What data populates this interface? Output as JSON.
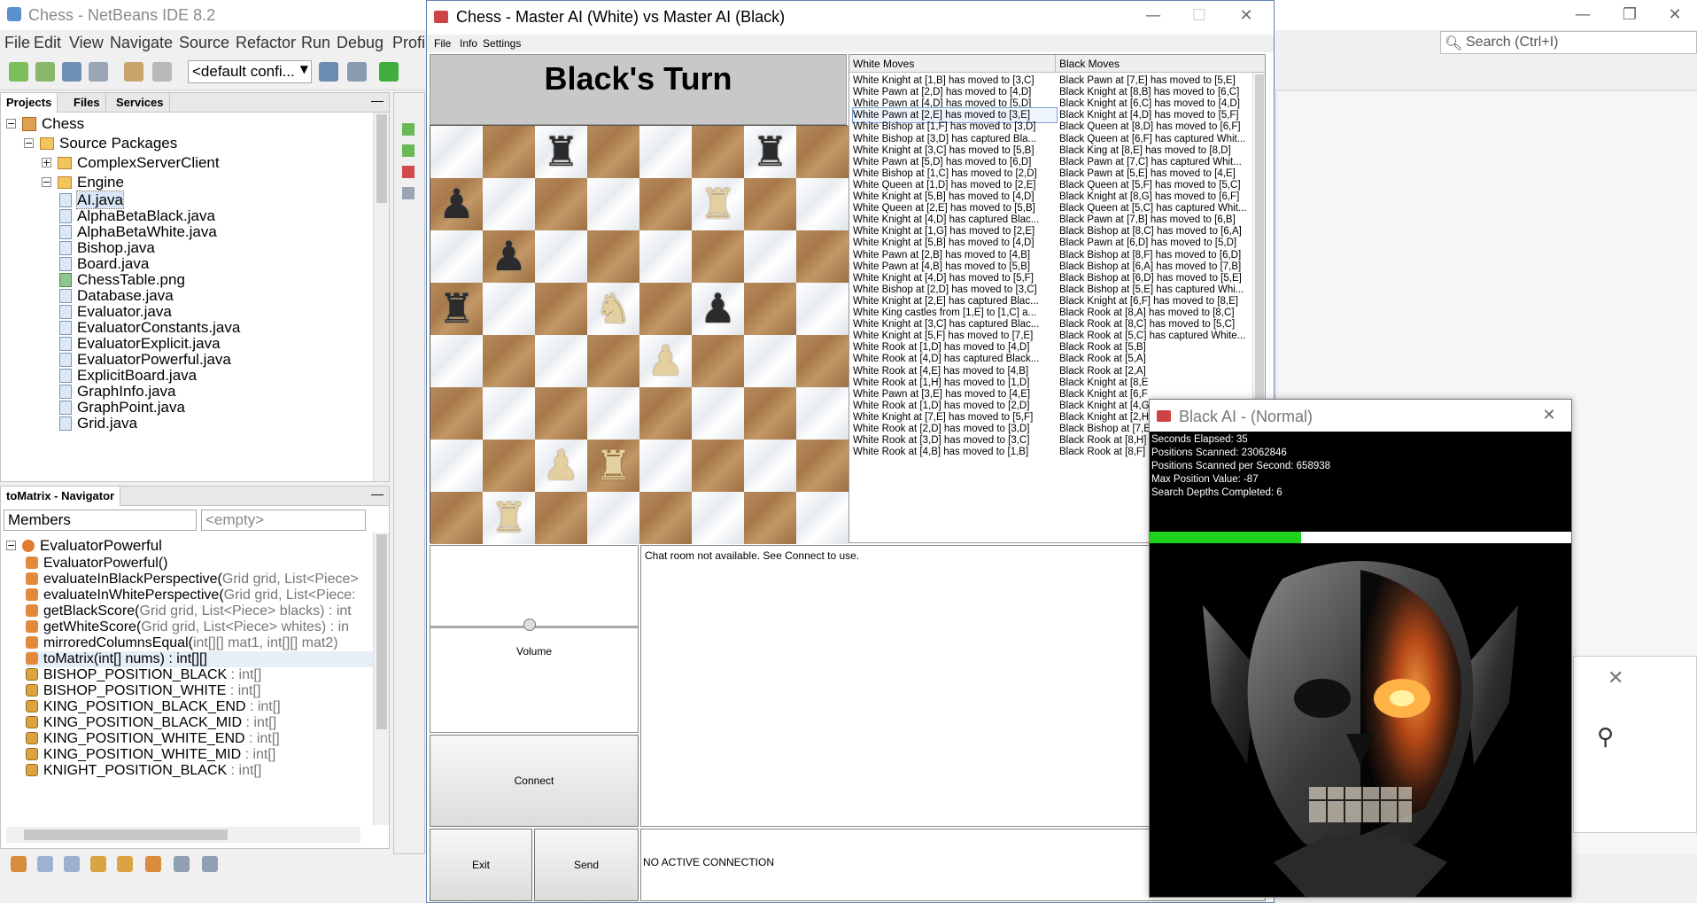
{
  "netbeans": {
    "title": "Chess - NetBeans IDE 8.2",
    "menu": [
      "File",
      "Edit",
      "View",
      "Navigate",
      "Source",
      "Refactor",
      "Run",
      "Debug",
      "Profi"
    ],
    "search_placeholder": "Search (Ctrl+I)",
    "config": "<default confi...",
    "projects": {
      "tabs": [
        "Projects",
        "Files",
        "Services"
      ],
      "root": "Chess",
      "source_packages": "Source Packages",
      "packages": [
        "ComplexServerClient",
        "Engine"
      ],
      "files": [
        "AI.java",
        "AlphaBetaBlack.java",
        "AlphaBetaWhite.java",
        "Bishop.java",
        "Board.java",
        "ChessTable.png",
        "Database.java",
        "Evaluator.java",
        "EvaluatorConstants.java",
        "EvaluatorExplicit.java",
        "EvaluatorPowerful.java",
        "ExplicitBoard.java",
        "GraphInfo.java",
        "GraphPoint.java",
        "Grid.java"
      ]
    },
    "navigator": {
      "title": "toMatrix - Navigator",
      "members_label": "Members",
      "filter_placeholder": "<empty>",
      "class_name": "EvaluatorPowerful",
      "members": [
        {
          "name": "EvaluatorPowerful()",
          "sig": "",
          "kind": "method"
        },
        {
          "name": "evaluateInBlackPerspective(",
          "sig": "Grid grid, List<Piece>",
          "kind": "method"
        },
        {
          "name": "evaluateInWhitePerspective(",
          "sig": "Grid grid, List<Piece:",
          "kind": "method"
        },
        {
          "name": "getBlackScore(",
          "sig": "Grid grid, List<Piece> blacks) : int",
          "kind": "method"
        },
        {
          "name": "getWhiteScore(",
          "sig": "Grid grid, List<Piece> whites) : in",
          "kind": "method"
        },
        {
          "name": "mirroredColumnsEqual(",
          "sig": "int[][] mat1, int[][] mat2)",
          "kind": "method"
        },
        {
          "name": "toMatrix(int[] nums) : int[][]",
          "sig": "",
          "kind": "method"
        },
        {
          "name": "BISHOP_POSITION_BLACK",
          "sig": " : int[]",
          "kind": "field"
        },
        {
          "name": "BISHOP_POSITION_WHITE",
          "sig": " : int[]",
          "kind": "field"
        },
        {
          "name": "KING_POSITION_BLACK_END",
          "sig": " : int[]",
          "kind": "field"
        },
        {
          "name": "KING_POSITION_BLACK_MID",
          "sig": " : int[]",
          "kind": "field"
        },
        {
          "name": "KING_POSITION_WHITE_END",
          "sig": " : int[]",
          "kind": "field"
        },
        {
          "name": "KING_POSITION_WHITE_MID",
          "sig": " : int[]",
          "kind": "field"
        },
        {
          "name": "KNIGHT_POSITION_BLACK",
          "sig": " : int[]",
          "kind": "field"
        }
      ]
    }
  },
  "chess": {
    "title": "Chess - Master AI (White) vs Master AI (Black)",
    "menu": [
      "File",
      "Info",
      "Settings"
    ],
    "turn": "Black's Turn",
    "board": [
      [
        "",
        "",
        "bR",
        "",
        "",
        "",
        "bR",
        ""
      ],
      [
        "bP",
        "",
        "",
        "",
        "",
        "wR",
        "",
        ""
      ],
      [
        "",
        "bP",
        "",
        "",
        "",
        "",
        "",
        ""
      ],
      [
        "bR",
        "",
        "",
        "wN",
        "",
        "bP",
        "",
        ""
      ],
      [
        "",
        "",
        "",
        "",
        "wP",
        "",
        "",
        ""
      ],
      [
        "",
        "",
        "",
        "",
        "",
        "",
        "",
        ""
      ],
      [
        "",
        "",
        "wP",
        "wR",
        "",
        "",
        "",
        ""
      ],
      [
        "",
        "wR",
        "",
        "",
        "",
        "",
        "",
        ""
      ]
    ],
    "moves_header": {
      "white": "White Moves",
      "black": "Black Moves"
    },
    "moves": [
      [
        "White Knight at [1,B] has moved to [3,C]",
        "Black Pawn at [7,E] has moved to [5,E]"
      ],
      [
        "White Pawn at [2,D] has moved to [4,D]",
        "Black Knight at [8,B] has moved to [6,C]"
      ],
      [
        "White Pawn at [4,D] has moved to [5,D]",
        "Black Knight at [6,C] has moved to [4,D]"
      ],
      [
        "White Pawn at [2,E] has moved to [3,E]",
        "Black Knight at [4,D] has moved to [5,F]"
      ],
      [
        "White Bishop at [1,F] has moved to [3,D]",
        "Black Queen at [8,D] has moved to [6,F]"
      ],
      [
        "White Bishop at [3,D] has captured Bla...",
        "Black Queen at [6,F] has captured Whit..."
      ],
      [
        "White Knight at [3,C] has moved to [5,B]",
        "Black King at [8,E] has moved to [8,D]"
      ],
      [
        "White Pawn at [5,D] has moved to [6,D]",
        "Black Pawn at [7,C] has captured Whit..."
      ],
      [
        "White Bishop at [1,C] has moved to [2,D]",
        "Black Pawn at [5,E] has moved to [4,E]"
      ],
      [
        "White Queen at [1,D] has moved to [2,E]",
        "Black Queen at [5,F] has moved to [5,C]"
      ],
      [
        "White Knight at [5,B] has moved to [4,D]",
        "Black Knight at [8,G] has moved to [6,F]"
      ],
      [
        "White Queen at [2,E] has moved to [5,B]",
        "Black Queen at [5,C] has captured Whit..."
      ],
      [
        "White Knight at [4,D] has captured Blac...",
        "Black Pawn at [7,B] has moved to [6,B]"
      ],
      [
        "White Knight at [1,G] has moved to [2,E]",
        "Black Bishop at [8,C] has moved to [6,A]"
      ],
      [
        "White Knight at [5,B] has moved to [4,D]",
        "Black Pawn at [6,D] has moved to [5,D]"
      ],
      [
        "White Pawn at [2,B] has moved to [4,B]",
        "Black Bishop at [8,F] has moved to [6,D]"
      ],
      [
        "White Pawn at [4,B] has moved to [5,B]",
        "Black Bishop at [6,A] has moved to [7,B]"
      ],
      [
        "White Knight at [4,D] has moved to [5,F]",
        "Black Bishop at [6,D] has moved to [5,E]"
      ],
      [
        "White Bishop at [2,D] has moved to [3,C]",
        "Black Bishop at [5,E] has captured Whi..."
      ],
      [
        "White Knight at [2,E] has captured Blac...",
        "Black Knight at [6,F] has moved to [8,E]"
      ],
      [
        "White King castles from [1,E] to [1,C] a...",
        "Black Rook at [8,A] has moved to [8,C]"
      ],
      [
        "White Knight at [3,C] has captured Blac...",
        "Black Rook at [8,C] has moved to [5,C]"
      ],
      [
        "White Knight at [5,F] has moved to [7,E]",
        "Black Rook at [5,C] has captured White..."
      ],
      [
        "White Rook at [1,D] has moved to [4,D]",
        "Black Rook at [5,B]"
      ],
      [
        "White Rook at [4,D] has captured Black...",
        "Black Rook at [5,A]"
      ],
      [
        "White Rook at [4,E] has moved to [4,B]",
        "Black Rook at [2,A]"
      ],
      [
        "White Rook at [1,H] has moved to [1,D]",
        "Black Knight at [8,E"
      ],
      [
        "White Pawn at [3,E] has moved to [4,E]",
        "Black Knight at [6,F"
      ],
      [
        "White Rook at [1,D] has moved to [2,D]",
        "Black Knight at [4,G"
      ],
      [
        "White Knight at [7,E] has moved to [5,F]",
        "Black Knight at [2,H"
      ],
      [
        "White Rook at [2,D] has moved to [3,D]",
        "Black Bishop at [7,E"
      ],
      [
        "White Rook at [3,D] has moved to [3,C]",
        "Black Rook at [8,H]"
      ],
      [
        "White Rook at [4,B] has moved to [1,B]",
        "Black Rook at [8,F]"
      ]
    ],
    "selected_move_index": 3,
    "volume_label": "Volume",
    "volume_level": 0.48,
    "connect_label": "Connect",
    "exit_label": "Exit",
    "send_label": "Send",
    "chat_text": "Chat room not available. See Connect to use.",
    "status_text": "NO ACTIVE CONNECTION"
  },
  "ai_window": {
    "title": "Black AI - (Normal)",
    "stats": [
      "Seconds Elapsed: 35",
      "Positions Scanned: 23062846",
      "Positions Scanned per Second: 658938",
      "Max Position Value: -87",
      "Search Depths Completed: 6"
    ],
    "progress": 0.36,
    "progress_color": "#1ed21e"
  }
}
